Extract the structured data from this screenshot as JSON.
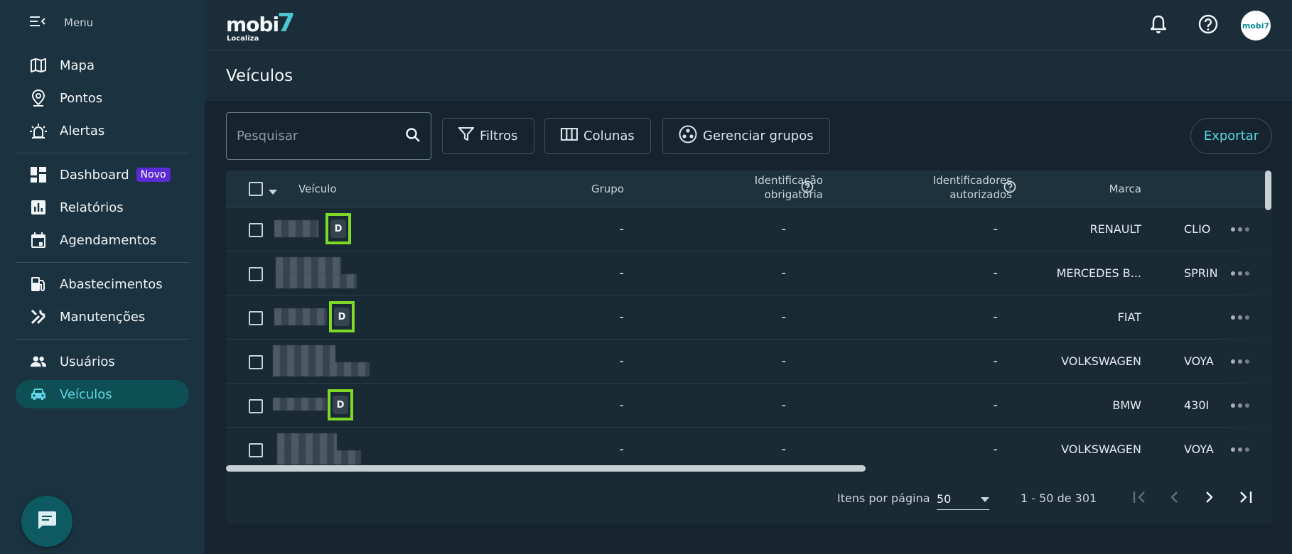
{
  "sidebar": {
    "menu_label": "Menu",
    "items": [
      {
        "label": "Mapa",
        "icon": "map-icon"
      },
      {
        "label": "Pontos",
        "icon": "location-pin-icon"
      },
      {
        "label": "Alertas",
        "icon": "alarm-light-icon"
      },
      {
        "label": "Dashboard",
        "icon": "dashboard-icon",
        "badge": "Novo"
      },
      {
        "label": "Relatórios",
        "icon": "bar-chart-icon"
      },
      {
        "label": "Agendamentos",
        "icon": "calendar-icon"
      },
      {
        "label": "Abastecimentos",
        "icon": "fuel-pump-icon"
      },
      {
        "label": "Manutenções",
        "icon": "tools-icon"
      },
      {
        "label": "Usuários",
        "icon": "users-icon"
      },
      {
        "label": "Veículos",
        "icon": "car-icon",
        "active": true
      }
    ]
  },
  "header": {
    "logo_word": "mobi",
    "logo_seven": "7",
    "logo_sub": "Localiza",
    "avatar_text": "mobi7"
  },
  "page": {
    "title": "Veículos"
  },
  "toolbar": {
    "search_placeholder": "Pesquisar",
    "filters_label": "Filtros",
    "columns_label": "Colunas",
    "groups_label": "Gerenciar grupos",
    "export_label": "Exportar"
  },
  "table": {
    "headers": {
      "vehicle": "Veículo",
      "group": "Grupo",
      "id_required_1": "Identificação",
      "id_required_2": "obrigatória",
      "authorized_1": "Identificadores",
      "authorized_2": "autorizados",
      "brand": "Marca"
    },
    "rows": [
      {
        "badge": "D",
        "group": "-",
        "id_required": "-",
        "authorized": "-",
        "brand": "RENAULT",
        "model": "CLIO"
      },
      {
        "badge": "",
        "group": "-",
        "id_required": "-",
        "authorized": "-",
        "brand": "MERCEDES B...",
        "model": "SPRIN"
      },
      {
        "badge": "D",
        "group": "-",
        "id_required": "-",
        "authorized": "-",
        "brand": "FIAT",
        "model": ""
      },
      {
        "badge": "",
        "group": "-",
        "id_required": "-",
        "authorized": "-",
        "brand": "VOLKSWAGEN",
        "model": "VOYA"
      },
      {
        "badge": "D",
        "group": "-",
        "id_required": "-",
        "authorized": "-",
        "brand": "BMW",
        "model": "430I"
      },
      {
        "badge": "",
        "group": "-",
        "id_required": "-",
        "authorized": "-",
        "brand": "VOLKSWAGEN",
        "model": "VOYA"
      }
    ]
  },
  "pagination": {
    "items_per_page_label": "Itens por página",
    "items_per_page_value": "50",
    "range": "1 - 50 de 301"
  },
  "colors": {
    "accent": "#5fd6e3",
    "active_nav_bg": "#0e4f55",
    "badge_purple": "#5b2bd6",
    "highlight_green": "#7fd824"
  }
}
